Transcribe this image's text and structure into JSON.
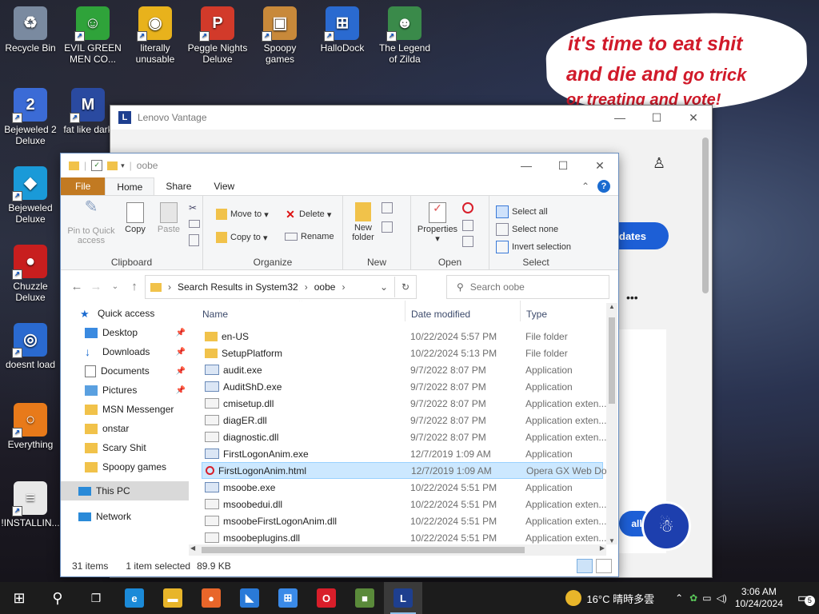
{
  "desktop": {
    "icons": [
      {
        "label": "Recycle Bin",
        "color": "#7a8aa0",
        "glyph": "♻"
      },
      {
        "label": "EVIL GREEN MEN CO...",
        "color": "#2fa33a",
        "glyph": "☺"
      },
      {
        "label": "literally unusable",
        "color": "#e8b21c",
        "glyph": "◉"
      },
      {
        "label": "Peggle Nights Deluxe",
        "color": "#d23a2a",
        "glyph": "P"
      },
      {
        "label": "Spoopy games",
        "color": "#c8893a",
        "glyph": "▣"
      },
      {
        "label": "HalloDock",
        "color": "#2a6ad0",
        "glyph": "⊞"
      },
      {
        "label": "The Legend of Zilda",
        "color": "#3a8a4a",
        "glyph": "☻"
      },
      {
        "label": "Bejeweled 2 Deluxe",
        "color": "#3b6bd6",
        "glyph": "2"
      },
      {
        "label": "fat like dark",
        "color": "#2a4aa0",
        "glyph": "M"
      },
      {
        "label": "Bejeweled Deluxe",
        "color": "#1a9ad8",
        "glyph": "◆"
      },
      {
        "label": "Chuzzle Deluxe",
        "color": "#c81e1e",
        "glyph": "●"
      },
      {
        "label": "doesnt load",
        "color": "#2a6ad0",
        "glyph": "◎"
      },
      {
        "label": "Everything",
        "color": "#e87a1a",
        "glyph": "○"
      },
      {
        "label": "!INSTALLIN...",
        "color": "#e8e8e8",
        "glyph": "≡"
      }
    ],
    "bubble": {
      "line1": "it's time to eat shit",
      "line2a": "and die and",
      "line2b": "go trick",
      "line3": "or treating and vote!"
    }
  },
  "lenovo": {
    "title": "Lenovo Vantage",
    "updates_btn": "dates",
    "all_btn": "all",
    "more": "•••"
  },
  "explorer": {
    "title_path": "oobe",
    "tabs": [
      "File",
      "Home",
      "Share",
      "View"
    ],
    "ribbon": {
      "clipboard": {
        "pin": "Pin to Quick access",
        "copy": "Copy",
        "paste": "Paste",
        "label": "Clipboard"
      },
      "organize": {
        "move_to": "Move to",
        "copy_to": "Copy to",
        "delete": "Delete",
        "rename": "Rename",
        "label": "Organize"
      },
      "new": {
        "new_folder": "New folder",
        "label": "New"
      },
      "open": {
        "properties": "Properties",
        "label": "Open"
      },
      "select": {
        "select_all": "Select all",
        "select_none": "Select none",
        "invert": "Invert selection",
        "label": "Select"
      }
    },
    "address": {
      "crumb1": "Search Results in System32",
      "crumb2": "oobe",
      "search_placeholder": "Search oobe"
    },
    "nav": {
      "quick_access": "Quick access",
      "items": [
        {
          "label": "Desktop",
          "pinned": true,
          "icon": "desktop-icon"
        },
        {
          "label": "Downloads",
          "pinned": true,
          "icon": "download-icon"
        },
        {
          "label": "Documents",
          "pinned": true,
          "icon": "document-icon"
        },
        {
          "label": "Pictures",
          "pinned": true,
          "icon": "picture-icon"
        },
        {
          "label": "MSN Messenger",
          "pinned": false,
          "icon": "folder-icon"
        },
        {
          "label": "onstar",
          "pinned": false,
          "icon": "folder-icon"
        },
        {
          "label": "Scary Shit",
          "pinned": false,
          "icon": "folder-icon"
        },
        {
          "label": "Spoopy games",
          "pinned": false,
          "icon": "folder-icon"
        }
      ],
      "this_pc": "This PC",
      "network": "Network"
    },
    "columns": {
      "name": "Name",
      "date": "Date modified",
      "type": "Type"
    },
    "files": [
      {
        "name": "en-US",
        "date": "10/22/2024 5:57 PM",
        "type": "File folder",
        "icon": "folder"
      },
      {
        "name": "SetupPlatform",
        "date": "10/22/2024 5:13 PM",
        "type": "File folder",
        "icon": "folder"
      },
      {
        "name": "audit.exe",
        "date": "9/7/2022 8:07 PM",
        "type": "Application",
        "icon": "exe"
      },
      {
        "name": "AuditShD.exe",
        "date": "9/7/2022 8:07 PM",
        "type": "Application",
        "icon": "exe"
      },
      {
        "name": "cmisetup.dll",
        "date": "9/7/2022 8:07 PM",
        "type": "Application exten...",
        "icon": "dll"
      },
      {
        "name": "diagER.dll",
        "date": "9/7/2022 8:07 PM",
        "type": "Application exten...",
        "icon": "dll"
      },
      {
        "name": "diagnostic.dll",
        "date": "9/7/2022 8:07 PM",
        "type": "Application exten...",
        "icon": "dll"
      },
      {
        "name": "FirstLogonAnim.exe",
        "date": "12/7/2019 1:09 AM",
        "type": "Application",
        "icon": "exe"
      },
      {
        "name": "FirstLogonAnim.html",
        "date": "12/7/2019 1:09 AM",
        "type": "Opera GX Web Do...",
        "icon": "html",
        "selected": true
      },
      {
        "name": "msoobe.exe",
        "date": "10/22/2024 5:51 PM",
        "type": "Application",
        "icon": "exe"
      },
      {
        "name": "msoobedui.dll",
        "date": "10/22/2024 5:51 PM",
        "type": "Application exten...",
        "icon": "dll"
      },
      {
        "name": "msoobeFirstLogonAnim.dll",
        "date": "10/22/2024 5:51 PM",
        "type": "Application exten...",
        "icon": "dll"
      },
      {
        "name": "msoobeplugins.dll",
        "date": "10/22/2024 5:51 PM",
        "type": "Application exten...",
        "icon": "dll"
      }
    ],
    "status": {
      "count": "31 items",
      "selected": "1 item selected",
      "size": "89.9 KB"
    }
  },
  "taskbar": {
    "apps": [
      {
        "name": "edge",
        "color": "#1b8ad8",
        "glyph": "e"
      },
      {
        "name": "file-explorer",
        "color": "#e8b52a",
        "glyph": "▬"
      },
      {
        "name": "firefox",
        "color": "#e8662a",
        "glyph": "●"
      },
      {
        "name": "app-blue",
        "color": "#2a7ad8",
        "glyph": "◣"
      },
      {
        "name": "store",
        "color": "#3a8ae8",
        "glyph": "⊞"
      },
      {
        "name": "opera",
        "color": "#d81e2a",
        "glyph": "O"
      },
      {
        "name": "minecraft",
        "color": "#5a8a3a",
        "glyph": "■"
      },
      {
        "name": "lenovo",
        "color": "#1e3f8f",
        "glyph": "L",
        "active": true
      }
    ],
    "weather": "16°C 晴時多雲",
    "time": "3:06 AM",
    "date": "10/24/2024",
    "notifications": "5"
  }
}
